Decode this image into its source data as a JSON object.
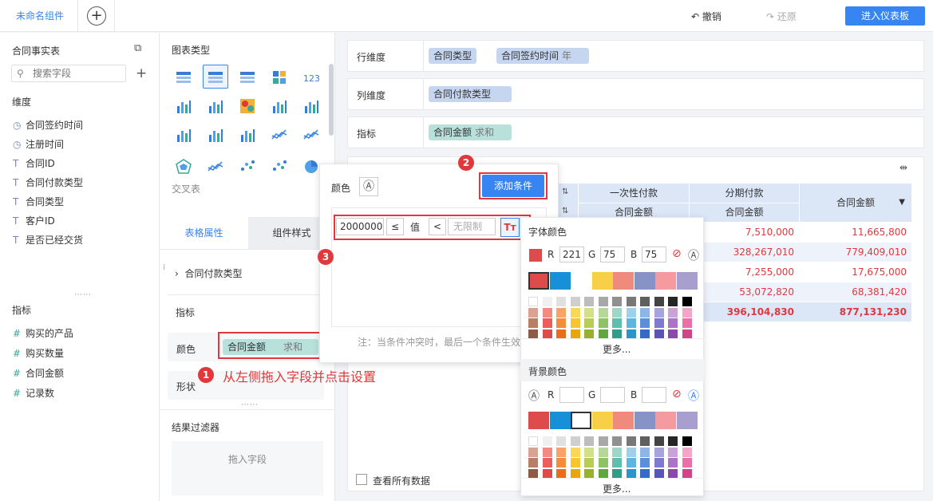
{
  "topbar": {
    "tab_name": "未命名组件",
    "undo": "撤销",
    "redo": "还原",
    "enter_dashboard": "进入仪表板"
  },
  "left": {
    "table_name": "合同事实表",
    "search_placeholder": "搜索字段",
    "dim_title": "维度",
    "dims": [
      "合同签约时间",
      "注册时间",
      "合同ID",
      "合同付款类型",
      "合同类型",
      "客户ID",
      "是否已经交货"
    ],
    "measure_title": "指标",
    "measures": [
      "购买的产品",
      "购买数量",
      "合同金额",
      "记录数"
    ]
  },
  "mid": {
    "chart_type_title": "图表类型",
    "cross_table": "交叉表",
    "tab_prop": "表格属性",
    "tab_style": "组件样式",
    "group_field": "合同付款类型",
    "measure_title": "指标",
    "color_label": "颜色",
    "color_field": "合同金额",
    "color_agg": "求和",
    "shape_label": "形状",
    "filter_title": "结果过滤器",
    "filter_drop": "拖入字段"
  },
  "main": {
    "row_dim_label": "行维度",
    "row_dims": [
      {
        "name": "合同类型"
      },
      {
        "name": "合同签约时间",
        "sub": "年"
      }
    ],
    "col_dim_label": "列维度",
    "col_dims": [
      "合同付款类型"
    ],
    "measure_label": "指标",
    "measure_pill": {
      "name": "合同金额",
      "sub": "求和"
    },
    "show_all": "查看所有数据",
    "table": {
      "headers": {
        "onetime": "一次性付款",
        "installment": "分期付款",
        "amount": "合同金额",
        "total": "合同金额"
      },
      "rows": [
        [
          "7,510,000",
          "11,665,800"
        ],
        [
          "328,267,010",
          "779,409,010"
        ],
        [
          "7,255,000",
          "17,675,000"
        ],
        [
          "53,072,820",
          "68,381,420"
        ],
        [
          "396,104,830",
          "877,131,230"
        ]
      ]
    }
  },
  "popup": {
    "color_label": "颜色",
    "add_condition": "添加条件",
    "value_input": "2000000",
    "op1": "≤",
    "mid": "值",
    "op2": "<",
    "unlimited": "无限制",
    "note": "注：当条件冲突时，最后一个条件生效"
  },
  "picker": {
    "font_color": "字体颜色",
    "r": "221",
    "g": "75",
    "b": "75",
    "more": "更多...",
    "bg_color": "背景颜色",
    "more2": "更多..."
  },
  "annotations": {
    "n1": "1",
    "n1_text": "从左侧拖入字段并点击设置",
    "n2": "2",
    "n3": "3"
  }
}
